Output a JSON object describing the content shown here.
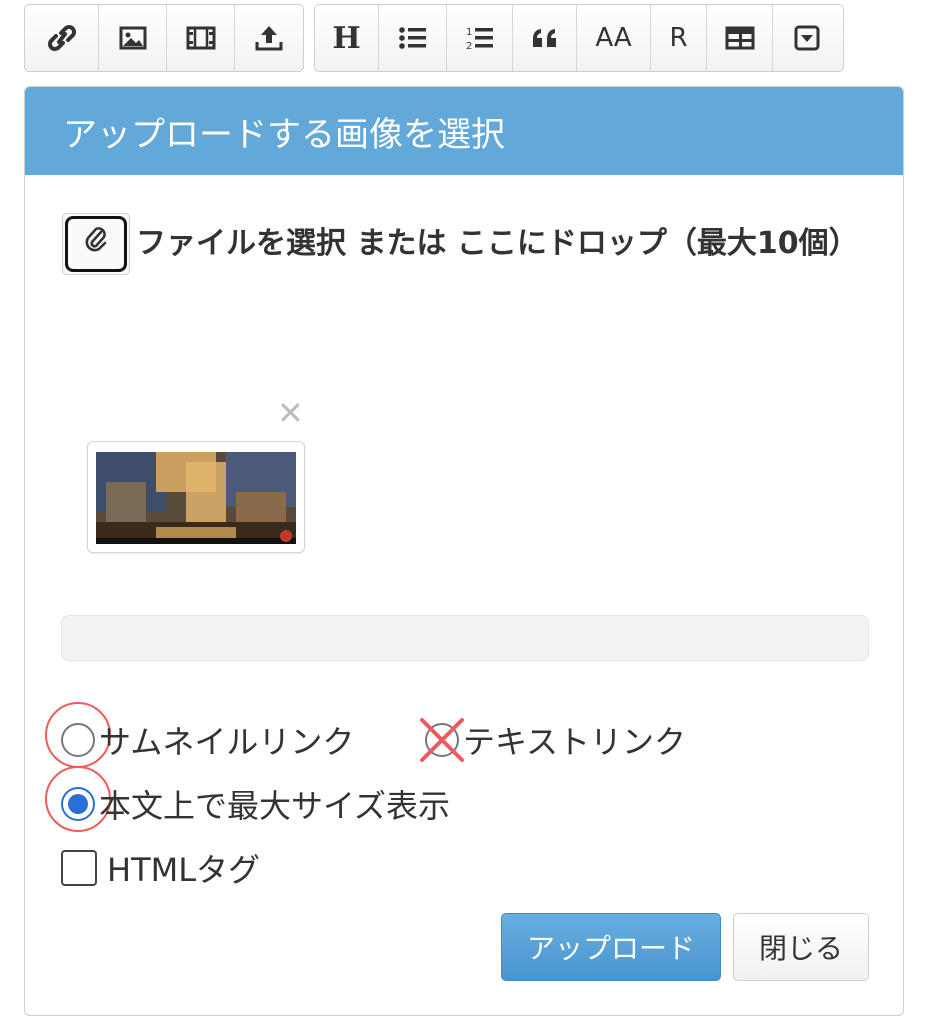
{
  "toolbar": {
    "group1": [
      {
        "name": "link-icon"
      },
      {
        "name": "image-icon"
      },
      {
        "name": "film-icon"
      },
      {
        "name": "upload-icon"
      }
    ],
    "group2": [
      {
        "name": "heading-icon",
        "label": "H"
      },
      {
        "name": "bullet-list-icon"
      },
      {
        "name": "numbered-list-icon"
      },
      {
        "name": "quote-icon"
      },
      {
        "name": "font-size-icon",
        "label": "AA"
      },
      {
        "name": "ruby-icon",
        "label": "R"
      },
      {
        "name": "table-icon"
      },
      {
        "name": "dropdown-icon"
      }
    ]
  },
  "dialog": {
    "title": "アップロードする画像を選択",
    "dropzone_text": "ファイルを選択 または ここにドロップ（最大10個）",
    "remove_symbol": "✕",
    "options": {
      "thumbnail_link": "サムネイルリンク",
      "text_link": "テキストリンク",
      "max_size": "本文上で最大サイズ表示",
      "html_tag": "HTMLタグ"
    },
    "buttons": {
      "upload": "アップロード",
      "close": "閉じる"
    }
  },
  "colors": {
    "header_bg": "#62a8d8",
    "primary": "#4a95cf",
    "radio_checked": "#2a6fd6",
    "annotation_red": "#ef5b5b"
  }
}
